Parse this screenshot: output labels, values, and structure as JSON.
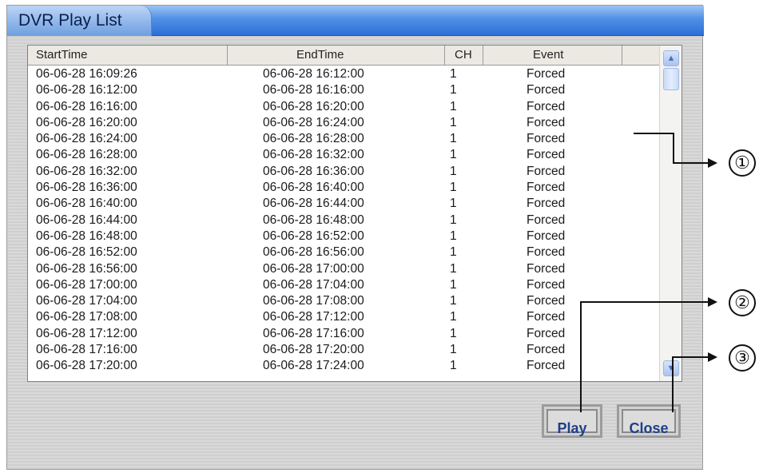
{
  "window": {
    "title": "DVR Play List"
  },
  "list": {
    "columns": [
      "StartTime",
      "EndTime",
      "CH",
      "Event"
    ],
    "rows": [
      [
        "06-06-28 16:09:26",
        "06-06-28 16:12:00",
        "1",
        "Forced"
      ],
      [
        "06-06-28 16:12:00",
        "06-06-28 16:16:00",
        "1",
        "Forced"
      ],
      [
        "06-06-28 16:16:00",
        "06-06-28 16:20:00",
        "1",
        "Forced"
      ],
      [
        "06-06-28 16:20:00",
        "06-06-28 16:24:00",
        "1",
        "Forced"
      ],
      [
        "06-06-28 16:24:00",
        "06-06-28 16:28:00",
        "1",
        "Forced"
      ],
      [
        "06-06-28 16:28:00",
        "06-06-28 16:32:00",
        "1",
        "Forced"
      ],
      [
        "06-06-28 16:32:00",
        "06-06-28 16:36:00",
        "1",
        "Forced"
      ],
      [
        "06-06-28 16:36:00",
        "06-06-28 16:40:00",
        "1",
        "Forced"
      ],
      [
        "06-06-28 16:40:00",
        "06-06-28 16:44:00",
        "1",
        "Forced"
      ],
      [
        "06-06-28 16:44:00",
        "06-06-28 16:48:00",
        "1",
        "Forced"
      ],
      [
        "06-06-28 16:48:00",
        "06-06-28 16:52:00",
        "1",
        "Forced"
      ],
      [
        "06-06-28 16:52:00",
        "06-06-28 16:56:00",
        "1",
        "Forced"
      ],
      [
        "06-06-28 16:56:00",
        "06-06-28 17:00:00",
        "1",
        "Forced"
      ],
      [
        "06-06-28 17:00:00",
        "06-06-28 17:04:00",
        "1",
        "Forced"
      ],
      [
        "06-06-28 17:04:00",
        "06-06-28 17:08:00",
        "1",
        "Forced"
      ],
      [
        "06-06-28 17:08:00",
        "06-06-28 17:12:00",
        "1",
        "Forced"
      ],
      [
        "06-06-28 17:12:00",
        "06-06-28 17:16:00",
        "1",
        "Forced"
      ],
      [
        "06-06-28 17:16:00",
        "06-06-28 17:20:00",
        "1",
        "Forced"
      ],
      [
        "06-06-28 17:20:00",
        "06-06-28 17:24:00",
        "1",
        "Forced"
      ]
    ]
  },
  "buttons": {
    "play": "Play",
    "close": "Close"
  },
  "callouts": [
    "①",
    "②",
    "③"
  ],
  "icons": {
    "scroll_up": "chevron-up-icon",
    "scroll_down": "chevron-down-icon"
  },
  "colors": {
    "title_gradient": "#2d6fd6",
    "button_text": "#1e3f8a"
  }
}
